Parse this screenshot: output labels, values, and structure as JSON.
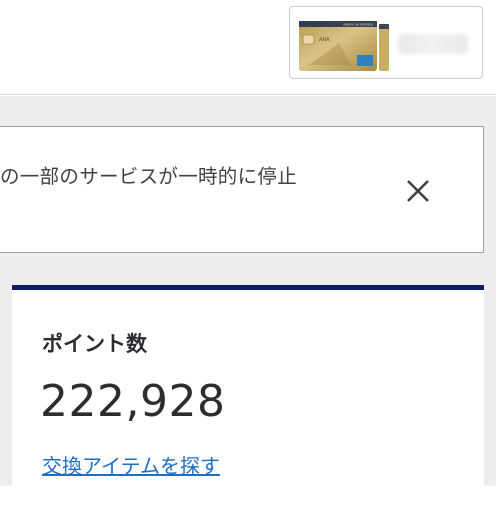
{
  "header": {
    "card_selector": {
      "card_brand_text": "ANA",
      "card_issuer_text": "AMERICAN EXPRESS"
    }
  },
  "notice": {
    "text": "の一部のサービスが一時的に停止",
    "close_icon": "close-icon"
  },
  "points": {
    "label": "ポイント数",
    "value": "222,928",
    "link": "交換アイテムを探す"
  },
  "colors": {
    "accent_navy": "#0a1f66",
    "link_blue": "#1f6dc6",
    "page_background": "#ededee"
  }
}
